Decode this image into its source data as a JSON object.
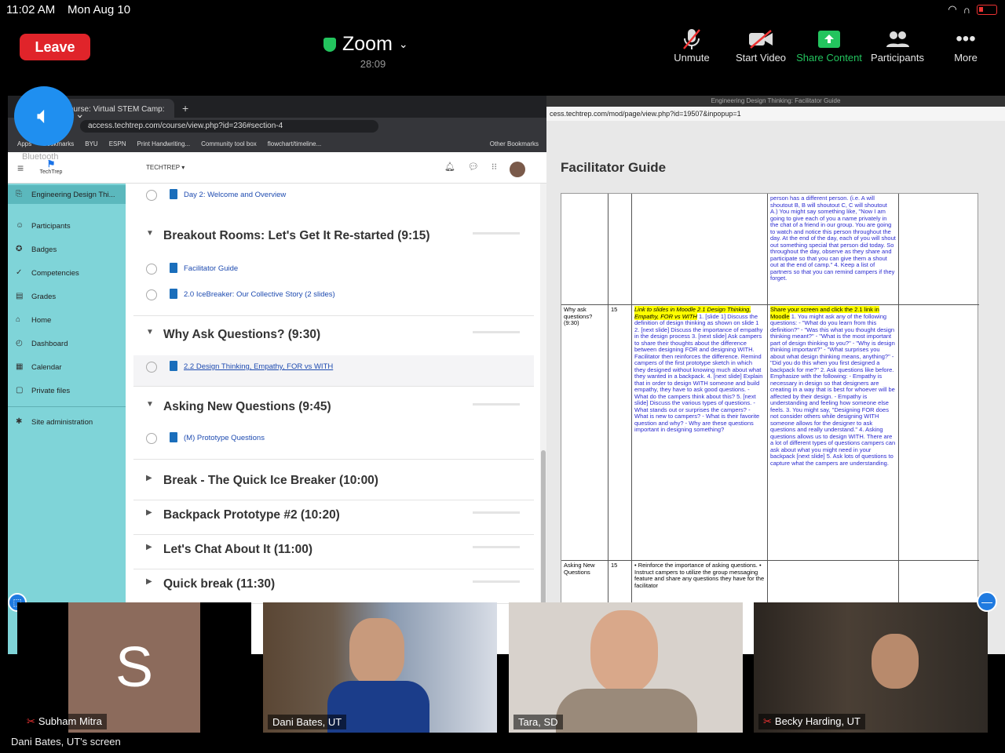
{
  "status": {
    "time": "11:02 AM",
    "date": "Mon Aug 10"
  },
  "toolbar": {
    "leave": "Leave",
    "meeting_title": "Zoom",
    "duration": "28:09",
    "buttons": [
      {
        "label": "Unmute",
        "icon": "mic-muted-icon"
      },
      {
        "label": "Start Video",
        "icon": "video-off-icon"
      },
      {
        "label": "Share Content",
        "icon": "share-screen-icon"
      },
      {
        "label": "Participants",
        "icon": "participants-icon"
      },
      {
        "label": "More",
        "icon": "more-icon"
      }
    ],
    "accent": "#23c45e",
    "leave_color": "#e0242a"
  },
  "audio_overlay": {
    "label": "Bluetooth"
  },
  "browser": {
    "tab_title": "ourse: Virtual STEM Camp: E",
    "url": "access.techtrep.com/course/view.php?id=236#section-4",
    "bookmarks": [
      "Apps",
      "Bookmarks",
      "BYU",
      "ESPN",
      "Print Handwriting...",
      "Community tool box",
      "flowchart/timeline...",
      "Other Bookmarks"
    ],
    "logo": "TechTrep",
    "menu_title": "TECHTREP",
    "nav": [
      {
        "label": "Engineering Design Thi...",
        "icon": "course-icon"
      },
      {
        "label": "Participants",
        "icon": "participants-icon"
      },
      {
        "label": "Badges",
        "icon": "badge-icon"
      },
      {
        "label": "Competencies",
        "icon": "competency-icon"
      },
      {
        "label": "Grades",
        "icon": "grades-icon"
      },
      {
        "label": "Home",
        "icon": "home-icon"
      },
      {
        "label": "Dashboard",
        "icon": "dashboard-icon"
      },
      {
        "label": "Calendar",
        "icon": "calendar-icon"
      },
      {
        "label": "Private files",
        "icon": "file-icon"
      },
      {
        "label": "Site administration",
        "icon": "admin-icon"
      }
    ],
    "sections": {
      "day2": "Day 2: Welcome and Overview",
      "breakout": "Breakout Rooms: Let's Get It Re-started (9:15)",
      "facilitator": "Facilitator Guide",
      "icebreaker": "2.0 IceBreaker: Our Collective Story (2 slides)",
      "why": "Why Ask Questions? (9:30)",
      "design": "2.2 Design Thinking, Empathy, FOR vs WITH",
      "asking": "Asking New Questions (9:45)",
      "prototype": "(M) Prototype Questions",
      "break": "Break - The Quick Ice Breaker (10:00)",
      "backpack": "Backpack Prototype #2 (10:20)",
      "chat": "Let's Chat About It (11:00)",
      "quick": "Quick break (11:30)"
    }
  },
  "guide": {
    "window_title": "Engineering Design Thinking: Facilitator Guide",
    "url": "cess.techtrep.com/mod/page/view.php?id=19507&inpopup=1",
    "title": "Facilitator Guide",
    "row1_text": "person has a different person. (i.e. A will shoutout B, B will shoutout C, C will shoutout A.) You might say something like, \"Now I am going to give each of you a name privately in the chat of a friend in our group. You are going to watch and notice this person throughout the day. At the end of the day, each of you will shout out something special that person did today. So throughout the day, observe as they share and participate so that you can give them a shout out at the end of camp.\" 4. Keep a list of partners so that you can remind campers if they forget.",
    "row2_label": "Why ask questions? (9:30)",
    "row2_time": "15",
    "row2_col3_hl": "Link to slides in Moodle 2.1 Design Thinking, Empathy, FOR vs WITH",
    "row2_col3": "1. [slide 1] Discuss the definition of design thinking as shown on slide 1 2. [next slide] Discuss the importance of empathy in the design process 3. [next slide] Ask campers to share their thoughts about the difference between designing FOR and designing WITH. Facilitator then reinforces the difference. Remind campers of the first prototype sketch in which they designed without knowing much about what they wanted in a backpack. 4. [next slide] Explain that in order to design WITH someone and build empathy, they have to ask good questions. - What do the campers think about this? 5. [next slide] Discuss the various types of questions. - What stands out or surprises the campers? - What is new to campers? - What is their favorite question and why? - Why are these questions important in designing something?",
    "row2_col4_hl": "Share your screen and click the 2.1 link in Moodle",
    "row2_col4": "1. You might ask any of the following questions: - \"What do you learn from this definition?\" - \"Was this what you thought design thinking meant?\" - \"What is the most important part of design thinking to you?\" - \"Why is design thinking important?\" - \"What surprises you about what design thinking means, anything?\" - \"Did you do this when you first designed a backpack for me?\" 2. Ask questions like before. Emphasize with the following: - Empathy is necessary in design so that designers are creating in a way that is best for whoever will be affected by their design. - Empathy is understanding and feeling how someone else feels. 3. You might say, \"Designing FOR does not consider others while designing WITH someone allows for the designer to ask questions and really understand.\" 4. Asking questions allows us to design WITH. There are a lot of different types of questions campers can ask about what you might need in your backpack [next slide] 5. Ask lots of questions to capture what the campers are understanding.",
    "row3_label": "Asking New Questions",
    "row3_time": "15",
    "row3_col3": "• Reinforce the importance of asking questions. • Instruct campers to utilize the group messaging feature and share any questions they have for the facilitator"
  },
  "participants": [
    {
      "name": "Subham Mitra",
      "initial": "S",
      "muted": true,
      "bg": "#8c6b5c"
    },
    {
      "name": "Dani Bates, UT",
      "muted": false,
      "bg": "#4a5a6a"
    },
    {
      "name": "Tara, SD",
      "muted": false,
      "bg": "#c8c0b8"
    },
    {
      "name": "Becky Harding, UT",
      "muted": true,
      "bg": "#3a3530"
    }
  ],
  "caption": "Dani Bates, UT's screen"
}
